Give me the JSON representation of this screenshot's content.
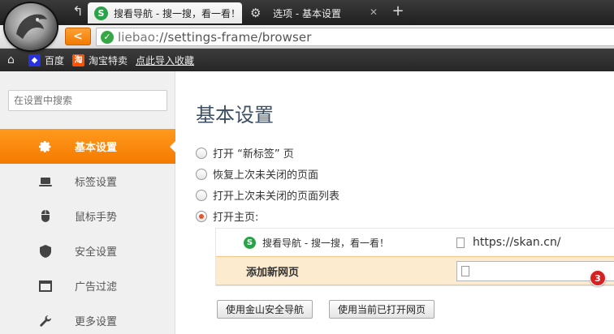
{
  "browser": {
    "tabs": [
      {
        "title": "搜看导航 - 搜一搜，看一看！",
        "icon": "s-logo-icon",
        "active": true
      },
      {
        "title": "选项 - 基本设置",
        "icon": "gear-icon",
        "active": false
      }
    ],
    "address": {
      "scheme": "liebao:",
      "rest": "//settings-frame/browser"
    },
    "bookmarks": [
      {
        "label": "百度",
        "icon": "baidu-icon"
      },
      {
        "label": "淘宝特卖",
        "icon": "taobao-icon"
      }
    ],
    "import_link": "点此导入收藏"
  },
  "sidebar": {
    "search_placeholder": "在设置中搜索",
    "items": [
      {
        "label": "基本设置",
        "icon": "gear-icon",
        "active": true
      },
      {
        "label": "标签设置",
        "icon": "laptop-icon"
      },
      {
        "label": "鼠标手势",
        "icon": "mouse-icon"
      },
      {
        "label": "安全设置",
        "icon": "shield-icon"
      },
      {
        "label": "广告过滤",
        "icon": "window-icon"
      },
      {
        "label": "更多设置",
        "icon": "wrench-icon"
      }
    ]
  },
  "main": {
    "title": "基本设置",
    "startup_options": [
      {
        "label": "打开 “新标签” 页",
        "checked": false
      },
      {
        "label": "恢复上次未关闭的页面",
        "checked": false
      },
      {
        "label": "打开上次未关闭的页面列表",
        "checked": false
      },
      {
        "label": "打开主页:",
        "checked": true
      }
    ],
    "homepage": {
      "name": "搜看导航 - 搜一搜，看一看！",
      "url": "https://skan.cn/",
      "add_label": "添加新网页",
      "add_value": "",
      "badge": "3"
    },
    "buttons": {
      "use_kingsoft": "使用金山安全导航",
      "use_current": "使用当前已打开网页"
    }
  },
  "colors": {
    "accent": "#f47a00",
    "checked": "#e8542c",
    "highlight_row": "#fdebd0",
    "badge": "#d92020"
  }
}
